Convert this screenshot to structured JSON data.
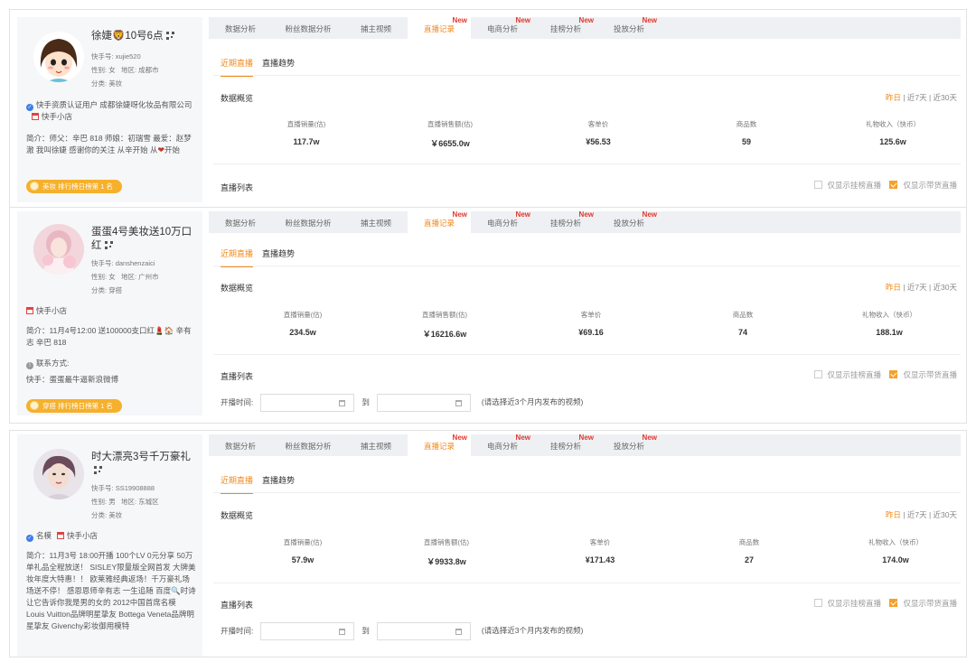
{
  "tabs": [
    "数据分析",
    "粉丝数据分析",
    "捕主视频",
    "直播记录",
    "电商分析",
    "挂榜分析",
    "投放分析"
  ],
  "new_badge": "New",
  "subtabs": [
    "近期直播",
    "直播趋势"
  ],
  "overview_title": "数据概览",
  "list_title": "直播列表",
  "ranges": [
    "昨日",
    "近7天",
    "近30天"
  ],
  "metric_labels": [
    "直播销量(估)",
    "直播销售额(估)",
    "客单价",
    "商品数",
    "礼物收入（快币）"
  ],
  "check_labels": [
    "仅显示挂榜直播",
    "仅显示带货直播"
  ],
  "date_label": "开播时间:",
  "date_to": "到",
  "date_hint": "(请选择近3个月内发布的视频)",
  "accent_color": "#f08a1b",
  "new_color": "#e03a2f",
  "streamers": [
    {
      "name": "徐婕🦁10号6点",
      "id_label": "快手号:",
      "id": "xujie520",
      "gender_label": "性别:",
      "gender": "女",
      "region_label": "地区:",
      "region": "成都市",
      "category_label": "分类:",
      "category": "美妆",
      "verify": "快手资质认证用户 成都徐婕呀化妆品有限公司",
      "shop": "快手小店",
      "bio": "简介：师父：辛巴 818 师娘：初瑞雪 最爱：赵梦澈 我叫徐婕 感谢你的关注 从辛开始 从",
      "bio_end": "开始",
      "rank": "美妆 排行榜日榜第 1 名",
      "values": [
        "117.7w",
        "￥6655.0w",
        "¥56.53",
        "59",
        "125.6w"
      ]
    },
    {
      "name": "蛋蛋4号美妆送10万口红",
      "id_label": "快手号:",
      "id": "danshenzaici",
      "gender_label": "性别:",
      "gender": "女",
      "region_label": "地区:",
      "region": "广州市",
      "category_label": "分类:",
      "category": "穿搭",
      "shop": "快手小店",
      "bio": "简介：11月4号12:00 送100000支口红💄🏠 辛有志 辛巴 818",
      "contact_label": "联系方式:",
      "contact": "快手：蛋蛋最牛逼新浪微博",
      "rank": "穿搭 排行榜日榜第 1 名",
      "values": [
        "234.5w",
        "￥16216.6w",
        "¥69.16",
        "74",
        "188.1w"
      ]
    },
    {
      "name": "时大漂亮3号千万豪礼",
      "id_label": "快手号:",
      "id": "SS19908888",
      "gender_label": "性别:",
      "gender": "男",
      "region_label": "地区:",
      "region": "东城区",
      "category_label": "分类:",
      "category": "美妆",
      "verify": "名模",
      "shop": "快手小店",
      "bio": "简介：11月3号 18:00开播 100个LV 0元分享 50万单礼品全程放送！ SISLEY限量版全网首发 大牌美妆年度大特惠！！ 欧莱雅经典返场！千万豪礼场场送不停！ 感恩恩师辛有志 一生追随 百度🔍时诗 让它告诉你我是男的女的 2012中国首席名模 Louis Vuitton品牌明星挚友 Bottega Veneta品牌明星挚友 Givenchy彩妆御用模特",
      "values": [
        "57.9w",
        "￥9933.8w",
        "¥171.43",
        "27",
        "174.0w"
      ]
    }
  ]
}
